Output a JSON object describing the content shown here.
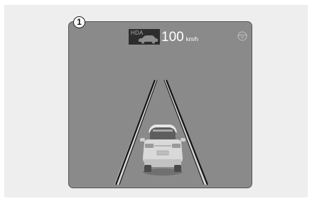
{
  "display": {
    "hda_badge": {
      "label": "HDA",
      "icon": "car-silhouette-icon"
    },
    "speed": {
      "value": "100",
      "unit": "km/h"
    },
    "status_icon": "steering-wheel-icon",
    "vehicle_icon": "vehicle-rear-view-icon",
    "lane_lines": "lane-lines"
  },
  "callout": {
    "number": "1"
  },
  "colors": {
    "display_background": "#8a8a8a",
    "badge_background": "#2d2d2d",
    "speed_text": "#ffffff",
    "lane_line": "#111111"
  }
}
